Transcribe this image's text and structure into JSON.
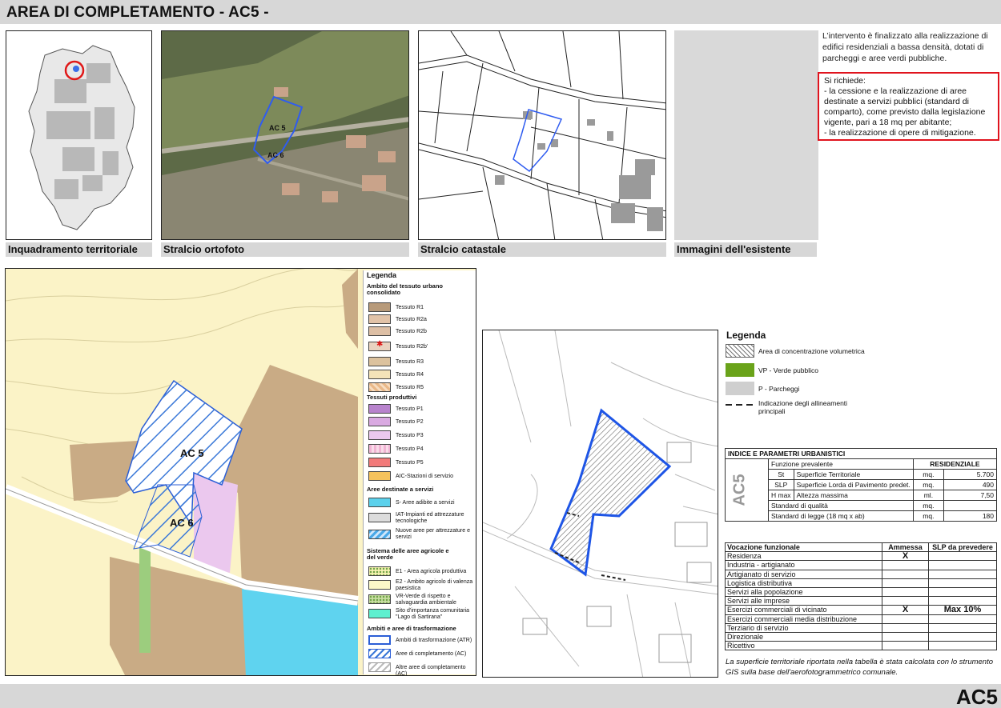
{
  "header": {
    "title": "AREA DI COMPLETAMENTO - AC5 -"
  },
  "footer": {
    "code": "AC5"
  },
  "captions": {
    "territorial": "Inquadramento territoriale",
    "ortofoto": "Stralcio ortofoto",
    "catastale": "Stralcio catastale",
    "existing": "Immagini dell'esistente"
  },
  "map_labels": {
    "ac5": "AC 5",
    "ac6": "AC 6"
  },
  "description": {
    "intro": "L’intervento è finalizzato alla realizzazione di edifici residenziali a bassa densità, dotati di parcheggi e aree verdi pubbliche.",
    "requirements_title": "Si richiede:",
    "req1": "- la cessione e la realizzazione di aree destinate a servizi pubblici (standard di comparto), come previsto dalla legislazione vigente, pari a 18 mq per abitante;",
    "req2": "- la realizzazione di opere di mitigazione."
  },
  "legend_map": {
    "title": "Legenda",
    "sections": [
      {
        "heading": "Ambito del tessuto urbano consolidato",
        "items": [
          {
            "label": "Tessuto R1",
            "color": "#b79a7a"
          },
          {
            "label": "Tessuto R2a",
            "color": "#e2c3a8"
          },
          {
            "label": "Tessuto R2b",
            "color": "#ddbfa5"
          },
          {
            "label": "Tessuto R2b'",
            "color": "#e9d3c0"
          },
          {
            "label": "Tessuto R3",
            "color": "#dcc29e"
          },
          {
            "label": "Tessuto R4",
            "color": "#f4e3b8"
          },
          {
            "label": "Tessuto R5",
            "color": "#e9b889"
          }
        ]
      },
      {
        "heading": "Tessuti produttivi",
        "items": [
          {
            "label": "Tessuto P1",
            "color": "#b883cd"
          },
          {
            "label": "Tessuto P2",
            "color": "#d9a9e1"
          },
          {
            "label": "Tessuto P3",
            "color": "#ecc9ef"
          },
          {
            "label": "Tessuto P4",
            "color": "#f1b4d4"
          },
          {
            "label": "Tessuto P5",
            "color": "#f27a7a"
          },
          {
            "label": "AIC-Stazioni di servizio",
            "color": "#f5c25c"
          }
        ]
      },
      {
        "heading": "Aree destinate a servizi",
        "items": [
          {
            "label": "S- Aree adibite a servizi",
            "color": "#5bd1ec"
          },
          {
            "label": "IAT-Impianti ed attrezzature tecnologiche",
            "color": "#dcdcdc"
          },
          {
            "label": "Nuove aree per attrezzature e servizi",
            "color": "#4aa9e8"
          }
        ]
      },
      {
        "heading": "Sistema delle aree agricole e del verde",
        "items": [
          {
            "label": "E1 - Area agricola produttiva",
            "color": "#f7f3b2"
          },
          {
            "label": "E2 - Ambito agricolo di valenza paesistica",
            "color": "#fbf7c9"
          },
          {
            "label": "VR-Verde di rispetto e salvaguardia ambientale",
            "color": "#c8dea2"
          },
          {
            "label": "Sito d'importanza comunitaria \"Lago di Sartirana\"",
            "color": "#5ef0cf"
          }
        ]
      },
      {
        "heading": "Ambiti e aree di trasformazione",
        "items": [
          {
            "label": "Ambiti di trasformazione (ATR)",
            "color": "#ffffff"
          },
          {
            "label": "Aree di completamento (AC)",
            "color": "#ffffff"
          },
          {
            "label": "Altre aree di completamento (AC)",
            "color": "#ffffff"
          }
        ]
      }
    ]
  },
  "legend_plan": {
    "title": "Legenda",
    "items": [
      {
        "label": "Area di concentrazione volumetrica"
      },
      {
        "label": "VP - Verde pubblico",
        "color": "#6aa31a"
      },
      {
        "label": "P -  Parcheggi",
        "color": "#cfcfcf"
      },
      {
        "label": "Indicazione degli allineamenti principali"
      }
    ]
  },
  "indices": {
    "title": "INDICE E PARAMETRI URBANISTICI",
    "code": "AC5",
    "function_label": "Funzione prevalente",
    "function_value": "RESIDENZIALE",
    "rows": [
      {
        "abbr": "St",
        "label": "Superficie Territoriale",
        "unit": "mq.",
        "value": "5.700"
      },
      {
        "abbr": "SLP",
        "label": "Superficie Lorda di Pavimento predet.",
        "unit": "mq.",
        "value": "490"
      },
      {
        "abbr": "H max",
        "label": "Altezza massima",
        "unit": "ml.",
        "value": "7,50"
      },
      {
        "abbr": "",
        "label": "Standard di qualità",
        "unit": "mq.",
        "value": ""
      },
      {
        "abbr": "",
        "label": "Standard di legge (18 mq x ab)",
        "unit": "mq.",
        "value": "180"
      }
    ]
  },
  "vocazione": {
    "header": "Vocazione funzionale",
    "col_ammessa": "Ammessa",
    "col_slp": "SLP da prevedere",
    "rows": [
      {
        "label": "Residenza",
        "ammessa": "X",
        "slp": ""
      },
      {
        "label": "Industria - artigianato",
        "ammessa": "",
        "slp": ""
      },
      {
        "label": "Artigianato di servizio",
        "ammessa": "",
        "slp": ""
      },
      {
        "label": "Logistica distributiva",
        "ammessa": "",
        "slp": ""
      },
      {
        "label": "Servizi alla popolazione",
        "ammessa": "",
        "slp": ""
      },
      {
        "label": "Servizi alle imprese",
        "ammessa": "",
        "slp": ""
      },
      {
        "label": "Esercizi commerciali di vicinato",
        "ammessa": "X",
        "slp": "Max 10%"
      },
      {
        "label": "Esercizi commerciali media distribuzione",
        "ammessa": "",
        "slp": ""
      },
      {
        "label": "Terziario di servizio",
        "ammessa": "",
        "slp": ""
      },
      {
        "label": "Direzionale",
        "ammessa": "",
        "slp": ""
      },
      {
        "label": "Ricettivo",
        "ammessa": "",
        "slp": ""
      }
    ]
  },
  "note": "La superficie territoriale riportata nella tabella è stata calcolata con lo strumento GIS sulla base dell'aerofotogrammetrico comunale."
}
